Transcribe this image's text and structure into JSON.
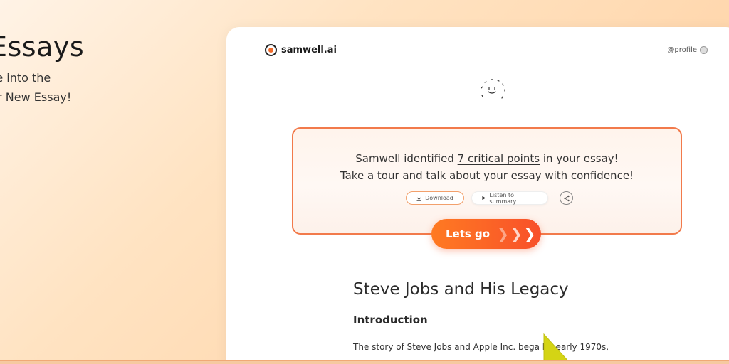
{
  "hero": {
    "title": "Essays",
    "line1": "se into the",
    "line2": "ur New Essay!"
  },
  "header": {
    "brand": "samwell.ai",
    "profile": "@profile"
  },
  "callout": {
    "line1_prefix": "Samwell identified ",
    "line1_link": "7 critical points",
    "line1_suffix": " in your essay!",
    "line2": "Take a tour and talk about your essay with confidence!",
    "download_label": "Download",
    "listen_label": "Listen to summary"
  },
  "cta": {
    "label": "Lets go"
  },
  "essay": {
    "title": "Steve Jobs and His Legacy",
    "heading": "Introduction",
    "paragraph": "The story of Steve Jobs and Apple Inc. bega    he early 1970s,"
  },
  "colors": {
    "accent": "#f8502a",
    "callout_border": "#f27a4b",
    "cursor": "#d4d414"
  },
  "icons": [
    "brand-logo-icon",
    "profile-avatar-icon",
    "mascot-icon",
    "download-icon",
    "play-icon",
    "share-icon",
    "chevron-right-icon",
    "pointer-cursor-icon"
  ]
}
